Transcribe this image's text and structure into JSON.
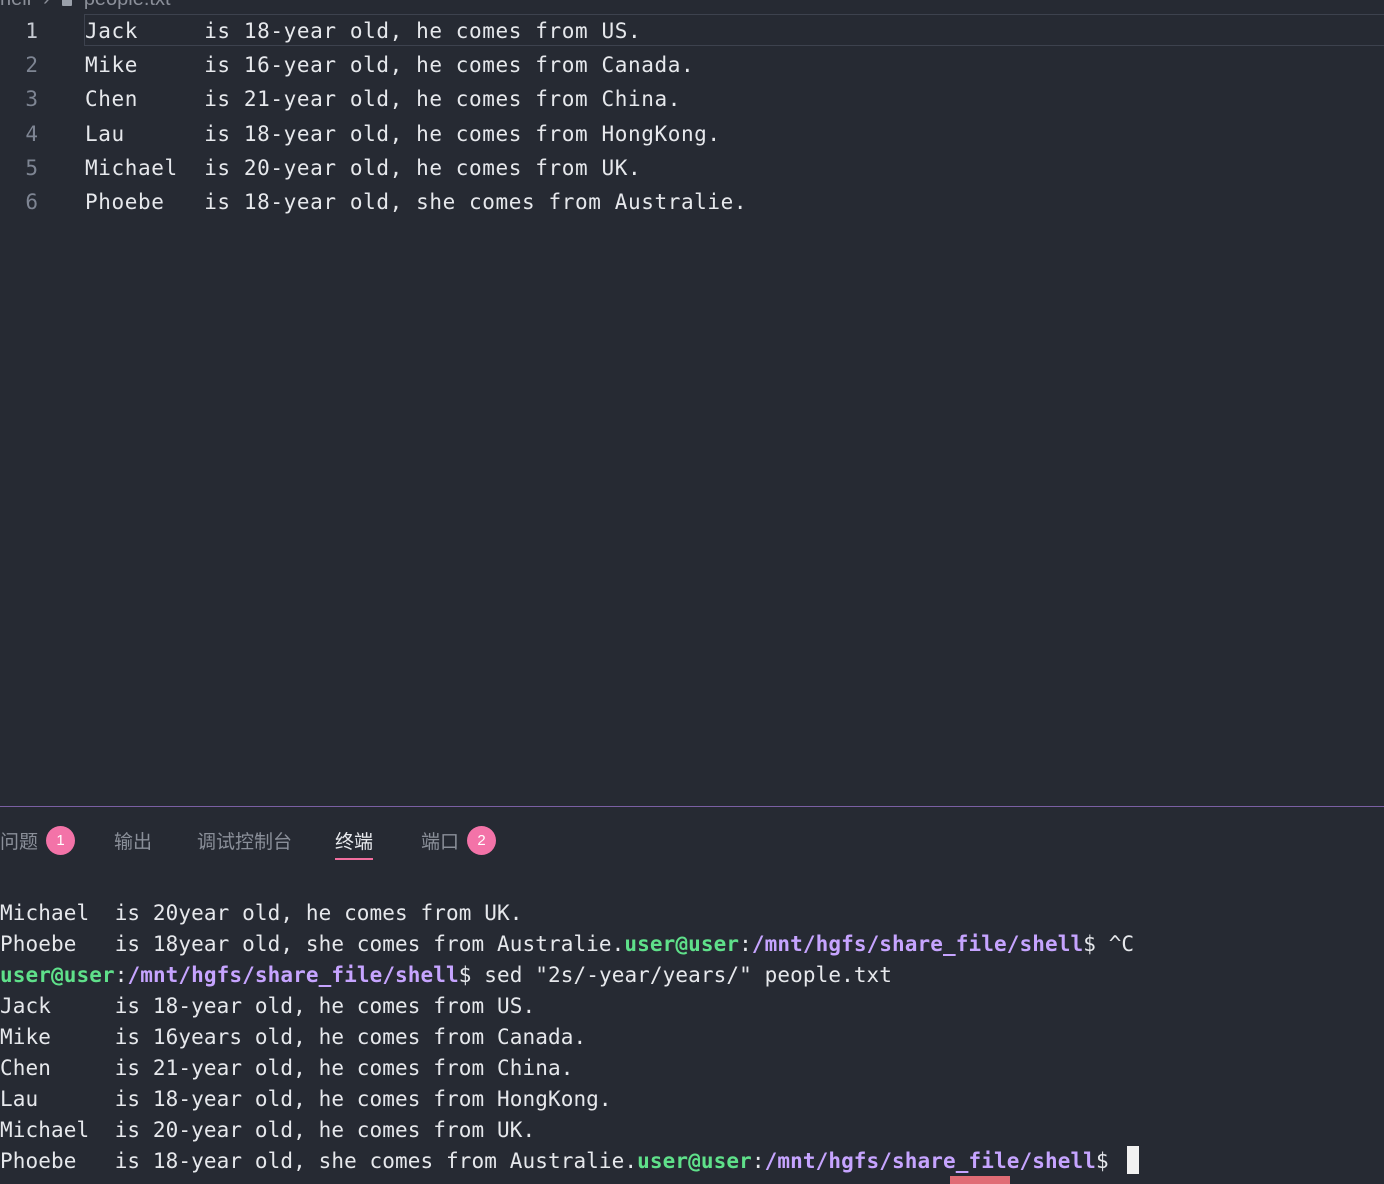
{
  "breadcrumb": {
    "folder": "hell",
    "file": "people.txt"
  },
  "editor": {
    "lines": [
      {
        "n": "1",
        "text": "Jack     is 18-year old, he comes from US."
      },
      {
        "n": "2",
        "text": "Mike     is 16-year old, he comes from Canada."
      },
      {
        "n": "3",
        "text": "Chen     is 21-year old, he comes from China."
      },
      {
        "n": "4",
        "text": "Lau      is 18-year old, he comes from HongKong."
      },
      {
        "n": "5",
        "text": "Michael  is 20-year old, he comes from UK."
      },
      {
        "n": "6",
        "text": "Phoebe   is 18-year old, she comes from Australie."
      }
    ]
  },
  "panel": {
    "tabs": [
      {
        "label": "问题",
        "badge": "1"
      },
      {
        "label": "输出"
      },
      {
        "label": "调试控制台"
      },
      {
        "label": "终端",
        "active": true
      },
      {
        "label": "端口",
        "badge": "2"
      }
    ]
  },
  "terminal": {
    "user": "user@user",
    "path": "/mnt/hgfs/share_file/shell",
    "line1": "Michael  is 20year old, he comes from UK.",
    "line2_text": "Phoebe   is 18year old, she comes from Australie.",
    "line2_cmd": "$ ^C",
    "line3_cmd": "$ sed \"2s/-year/years/\" people.txt",
    "output": [
      "Jack     is 18-year old, he comes from US.",
      "Mike     is 16years old, he comes from Canada.",
      "Chen     is 21-year old, he comes from China.",
      "Lau      is 18-year old, he comes from HongKong.",
      "Michael  is 20-year old, he comes from UK."
    ],
    "last_text": "Phoebe   is 18-year old, she comes from Australie.",
    "last_cmd": "$ "
  },
  "colors": {
    "accent": "#f06e9e",
    "badge": "#f373a8",
    "prompt_user": "#5fe08a",
    "prompt_path": "#c6a4ff"
  }
}
